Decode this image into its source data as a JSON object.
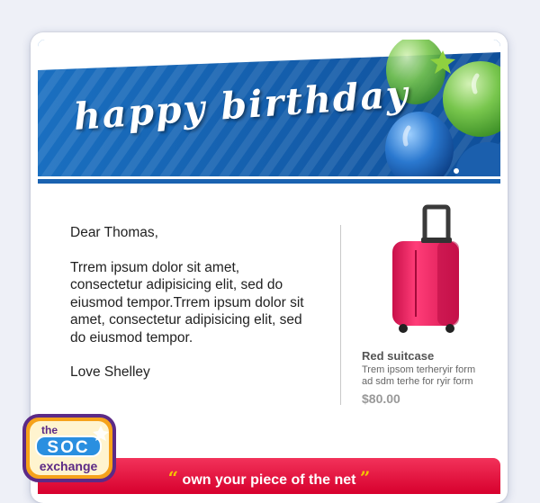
{
  "banner": {
    "headline": "happy birthday"
  },
  "letter": {
    "greeting": "Dear Thomas,",
    "body_lines": [
      "Trrem ipsum dolor sit amet,",
      "consectetur adipisicing elit, sed do",
      "eiusmod tempor.Trrem ipsum dolor sit",
      "amet, consectetur adipisicing elit, sed",
      "do eiusmod tempor."
    ],
    "signoff": "Love Shelley"
  },
  "product": {
    "name": "Red suitcase",
    "description_lines": [
      "Trem ipsom terheryir form",
      "ad sdm terhe for ryir form"
    ],
    "price": "$80.00"
  },
  "footer": {
    "tagline": "own your piece of the net",
    "quote_open": "“",
    "quote_close": "”"
  },
  "logo": {
    "top": "the",
    "middle": "SOC",
    "bottom": "exchange"
  },
  "colors": {
    "banner_blue": "#1667b7",
    "footer_red": "#e2123f",
    "quote_yellow": "#f5c400",
    "logo_orange": "#f6a21a"
  },
  "icons": {
    "balloons": "balloons-illustration",
    "suitcase": "suitcase-image"
  }
}
